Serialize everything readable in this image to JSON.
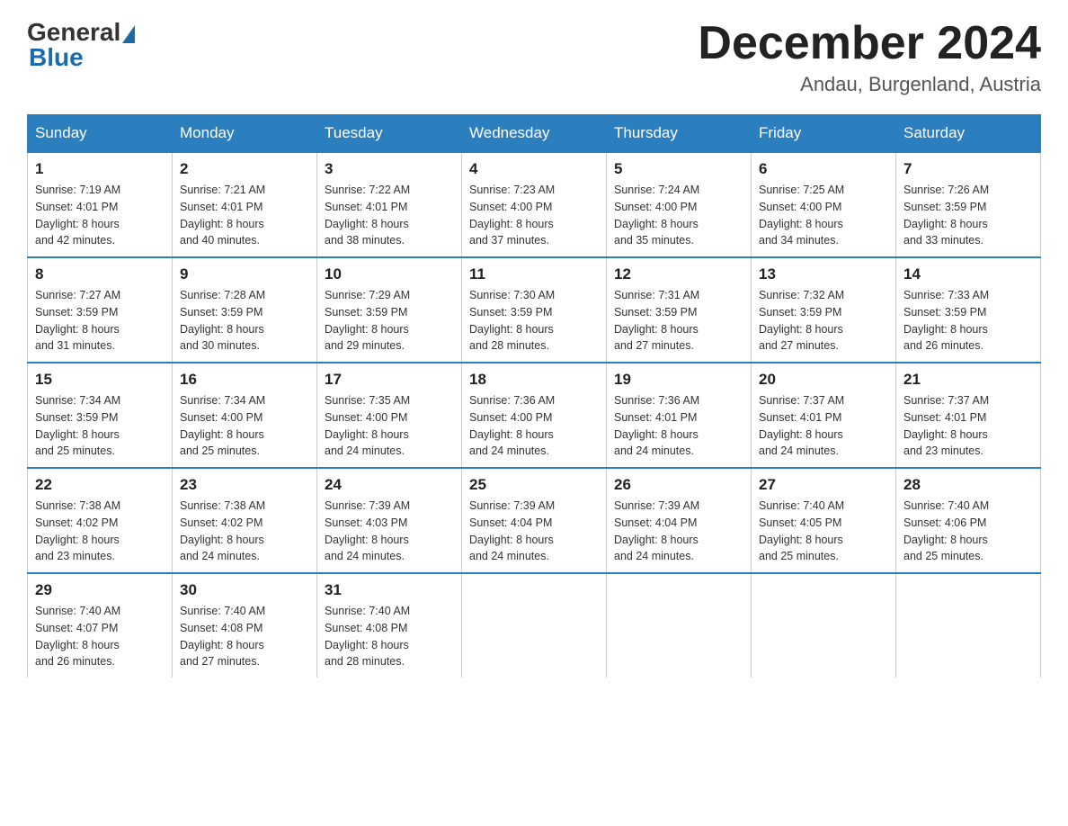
{
  "header": {
    "logo_general": "General",
    "logo_blue": "Blue",
    "month_title": "December 2024",
    "location": "Andau, Burgenland, Austria"
  },
  "days_of_week": [
    "Sunday",
    "Monday",
    "Tuesday",
    "Wednesday",
    "Thursday",
    "Friday",
    "Saturday"
  ],
  "weeks": [
    [
      {
        "day": "1",
        "sunrise": "7:19 AM",
        "sunset": "4:01 PM",
        "daylight": "8 hours and 42 minutes."
      },
      {
        "day": "2",
        "sunrise": "7:21 AM",
        "sunset": "4:01 PM",
        "daylight": "8 hours and 40 minutes."
      },
      {
        "day": "3",
        "sunrise": "7:22 AM",
        "sunset": "4:01 PM",
        "daylight": "8 hours and 38 minutes."
      },
      {
        "day": "4",
        "sunrise": "7:23 AM",
        "sunset": "4:00 PM",
        "daylight": "8 hours and 37 minutes."
      },
      {
        "day": "5",
        "sunrise": "7:24 AM",
        "sunset": "4:00 PM",
        "daylight": "8 hours and 35 minutes."
      },
      {
        "day": "6",
        "sunrise": "7:25 AM",
        "sunset": "4:00 PM",
        "daylight": "8 hours and 34 minutes."
      },
      {
        "day": "7",
        "sunrise": "7:26 AM",
        "sunset": "3:59 PM",
        "daylight": "8 hours and 33 minutes."
      }
    ],
    [
      {
        "day": "8",
        "sunrise": "7:27 AM",
        "sunset": "3:59 PM",
        "daylight": "8 hours and 31 minutes."
      },
      {
        "day": "9",
        "sunrise": "7:28 AM",
        "sunset": "3:59 PM",
        "daylight": "8 hours and 30 minutes."
      },
      {
        "day": "10",
        "sunrise": "7:29 AM",
        "sunset": "3:59 PM",
        "daylight": "8 hours and 29 minutes."
      },
      {
        "day": "11",
        "sunrise": "7:30 AM",
        "sunset": "3:59 PM",
        "daylight": "8 hours and 28 minutes."
      },
      {
        "day": "12",
        "sunrise": "7:31 AM",
        "sunset": "3:59 PM",
        "daylight": "8 hours and 27 minutes."
      },
      {
        "day": "13",
        "sunrise": "7:32 AM",
        "sunset": "3:59 PM",
        "daylight": "8 hours and 27 minutes."
      },
      {
        "day": "14",
        "sunrise": "7:33 AM",
        "sunset": "3:59 PM",
        "daylight": "8 hours and 26 minutes."
      }
    ],
    [
      {
        "day": "15",
        "sunrise": "7:34 AM",
        "sunset": "3:59 PM",
        "daylight": "8 hours and 25 minutes."
      },
      {
        "day": "16",
        "sunrise": "7:34 AM",
        "sunset": "4:00 PM",
        "daylight": "8 hours and 25 minutes."
      },
      {
        "day": "17",
        "sunrise": "7:35 AM",
        "sunset": "4:00 PM",
        "daylight": "8 hours and 24 minutes."
      },
      {
        "day": "18",
        "sunrise": "7:36 AM",
        "sunset": "4:00 PM",
        "daylight": "8 hours and 24 minutes."
      },
      {
        "day": "19",
        "sunrise": "7:36 AM",
        "sunset": "4:01 PM",
        "daylight": "8 hours and 24 minutes."
      },
      {
        "day": "20",
        "sunrise": "7:37 AM",
        "sunset": "4:01 PM",
        "daylight": "8 hours and 24 minutes."
      },
      {
        "day": "21",
        "sunrise": "7:37 AM",
        "sunset": "4:01 PM",
        "daylight": "8 hours and 23 minutes."
      }
    ],
    [
      {
        "day": "22",
        "sunrise": "7:38 AM",
        "sunset": "4:02 PM",
        "daylight": "8 hours and 23 minutes."
      },
      {
        "day": "23",
        "sunrise": "7:38 AM",
        "sunset": "4:02 PM",
        "daylight": "8 hours and 24 minutes."
      },
      {
        "day": "24",
        "sunrise": "7:39 AM",
        "sunset": "4:03 PM",
        "daylight": "8 hours and 24 minutes."
      },
      {
        "day": "25",
        "sunrise": "7:39 AM",
        "sunset": "4:04 PM",
        "daylight": "8 hours and 24 minutes."
      },
      {
        "day": "26",
        "sunrise": "7:39 AM",
        "sunset": "4:04 PM",
        "daylight": "8 hours and 24 minutes."
      },
      {
        "day": "27",
        "sunrise": "7:40 AM",
        "sunset": "4:05 PM",
        "daylight": "8 hours and 25 minutes."
      },
      {
        "day": "28",
        "sunrise": "7:40 AM",
        "sunset": "4:06 PM",
        "daylight": "8 hours and 25 minutes."
      }
    ],
    [
      {
        "day": "29",
        "sunrise": "7:40 AM",
        "sunset": "4:07 PM",
        "daylight": "8 hours and 26 minutes."
      },
      {
        "day": "30",
        "sunrise": "7:40 AM",
        "sunset": "4:08 PM",
        "daylight": "8 hours and 27 minutes."
      },
      {
        "day": "31",
        "sunrise": "7:40 AM",
        "sunset": "4:08 PM",
        "daylight": "8 hours and 28 minutes."
      },
      null,
      null,
      null,
      null
    ]
  ],
  "labels": {
    "sunrise": "Sunrise:",
    "sunset": "Sunset:",
    "daylight": "Daylight:"
  }
}
